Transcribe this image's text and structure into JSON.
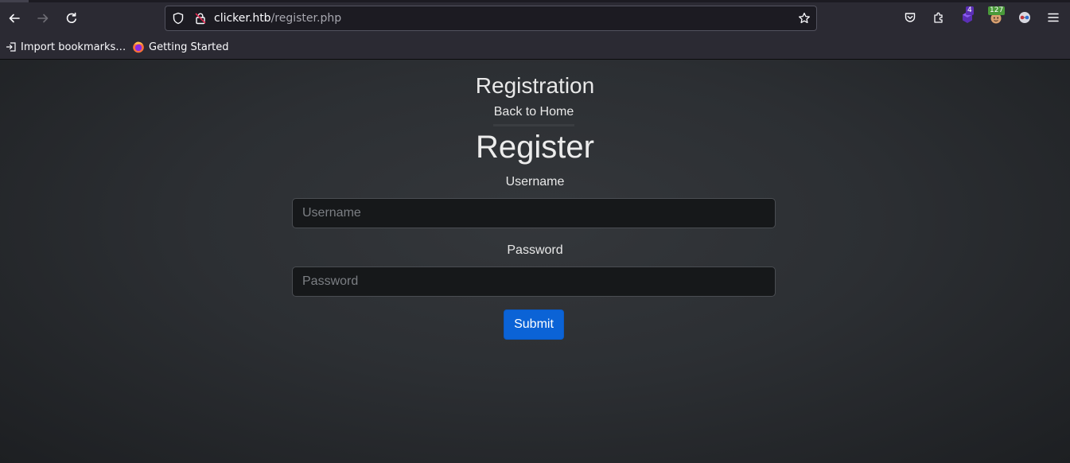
{
  "browser": {
    "url_host": "clicker.htb",
    "url_path": "/register.php",
    "extensions": {
      "badge_one": "4",
      "badge_two": "127"
    },
    "bookmarks": [
      {
        "label": "Import bookmarks…",
        "icon": "import-icon"
      },
      {
        "label": "Getting Started",
        "icon": "firefox-icon"
      }
    ]
  },
  "page": {
    "site_title": "Registration",
    "back_link": "Back to Home",
    "heading": "Register",
    "username_label": "Username",
    "username_placeholder": "Username",
    "username_value": "",
    "password_label": "Password",
    "password_placeholder": "Password",
    "password_value": "",
    "submit_label": "Submit"
  },
  "colors": {
    "browser_chrome": "#2b2a33",
    "page_background": "#2c2f33",
    "submit_button": "#0b63d6",
    "input_background": "#16181a"
  }
}
